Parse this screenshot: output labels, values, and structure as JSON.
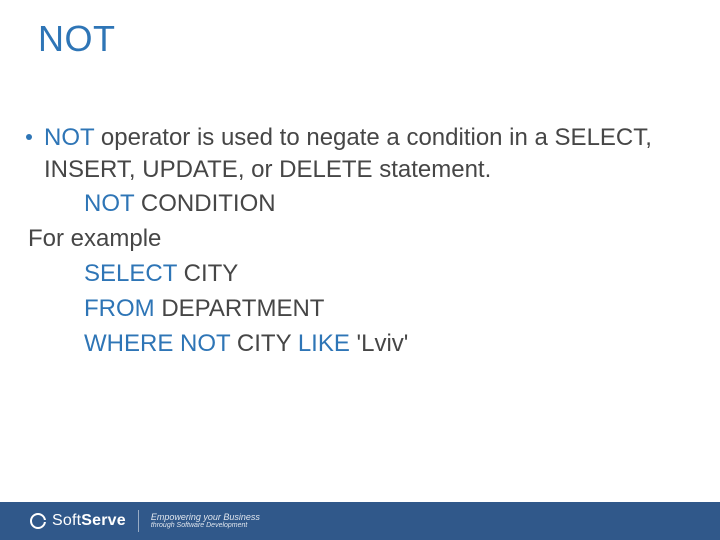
{
  "title": "NOT",
  "bullet": {
    "kw": "NOT",
    "rest": " operator is used to negate a condition in a SELECT, INSERT, UPDATE, or DELETE statement."
  },
  "syntax": {
    "kw": "NOT",
    "rest": " CONDITION"
  },
  "example_label": "For example",
  "sql": {
    "line1": {
      "kw": "SELECT",
      "rest": " CITY"
    },
    "line2": {
      "kw": "FROM",
      "rest": " DEPARTMENT"
    },
    "line3": {
      "kw1": "WHERE NOT",
      "mid": " CITY ",
      "kw2": "LIKE",
      "rest": " 'Lviv'"
    }
  },
  "footer": {
    "brand_prefix": "Soft",
    "brand_suffix": "Serve",
    "tagline1": "Empowering your Business",
    "tagline2": "through Software Development"
  }
}
